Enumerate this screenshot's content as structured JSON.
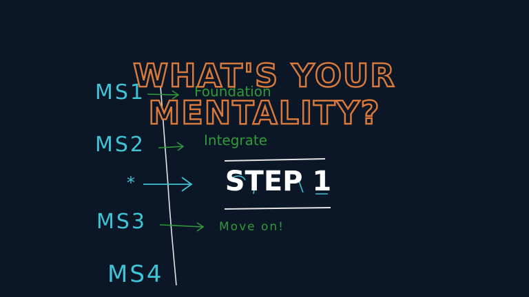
{
  "slide": {
    "title_line1": "WHAT'S YOUR",
    "title_line2": "MENTALITY?",
    "step_label": "STEP 1",
    "colors": {
      "background": "#0b1726",
      "title_outline": "#d97a3c",
      "milestone_ink": "#3fc4d6",
      "note_ink": "#2f9a3a",
      "axis_ink": "#e6e6e6",
      "step_text": "#ffffff"
    }
  },
  "sketch": {
    "milestones": [
      {
        "label": "MS1",
        "note": "Foundation"
      },
      {
        "label": "MS2",
        "note": "Integrate"
      },
      {
        "label": "*",
        "note": ""
      },
      {
        "label": "MS3",
        "note": "Move on!"
      },
      {
        "label": "MS4",
        "note": ""
      }
    ]
  }
}
